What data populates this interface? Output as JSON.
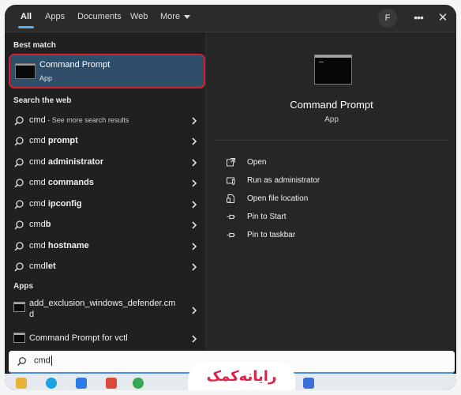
{
  "filter_bar": {
    "tabs": [
      {
        "label": "All",
        "active": true
      },
      {
        "label": "Apps",
        "active": false
      },
      {
        "label": "Documents",
        "active": false
      },
      {
        "label": "Web",
        "active": false
      },
      {
        "label": "More",
        "active": false
      }
    ],
    "avatar_letter": "F",
    "options_icon": "more-dots-icon",
    "close_icon": "close-icon"
  },
  "results": {
    "best_match_label": "Best match",
    "best_match": {
      "title": "Command Prompt",
      "subtitle": "App",
      "icon": "command-prompt-icon"
    },
    "web_label": "Search the web",
    "web_items": [
      {
        "prefix": "cmd",
        "bold": "",
        "suffix": " - See more search results"
      },
      {
        "prefix": "cmd ",
        "bold": "prompt",
        "suffix": ""
      },
      {
        "prefix": "cmd ",
        "bold": "administrator",
        "suffix": ""
      },
      {
        "prefix": "cmd ",
        "bold": "commands",
        "suffix": ""
      },
      {
        "prefix": "cmd ",
        "bold": "ipconfig",
        "suffix": ""
      },
      {
        "prefix": "cmd",
        "bold": "b",
        "suffix": ""
      },
      {
        "prefix": "cmd ",
        "bold": "hostname",
        "suffix": ""
      },
      {
        "prefix": "cmd",
        "bold": "let",
        "suffix": ""
      }
    ],
    "apps_label": "Apps",
    "app_items": [
      {
        "line1": "add_exclusion_windows_defender.cm",
        "line2": "d"
      },
      {
        "line1": "Command Prompt for vctl",
        "line2": ""
      }
    ]
  },
  "preview": {
    "title": "Command Prompt",
    "subtitle": "App",
    "actions": [
      {
        "label": "Open",
        "icon": "open-icon"
      },
      {
        "label": "Run as administrator",
        "icon": "shield-icon"
      },
      {
        "label": "Open file location",
        "icon": "file-location-icon"
      },
      {
        "label": "Pin to Start",
        "icon": "pin-icon"
      },
      {
        "label": "Pin to taskbar",
        "icon": "pin-icon"
      }
    ]
  },
  "search": {
    "value": "cmd"
  },
  "watermark": "رایانه‌کمک",
  "colors": {
    "accent": "#5cb0f0",
    "selection_bg": "#2f4e6a",
    "highlight_border": "#d3202b",
    "watermark": "#e0224a"
  }
}
